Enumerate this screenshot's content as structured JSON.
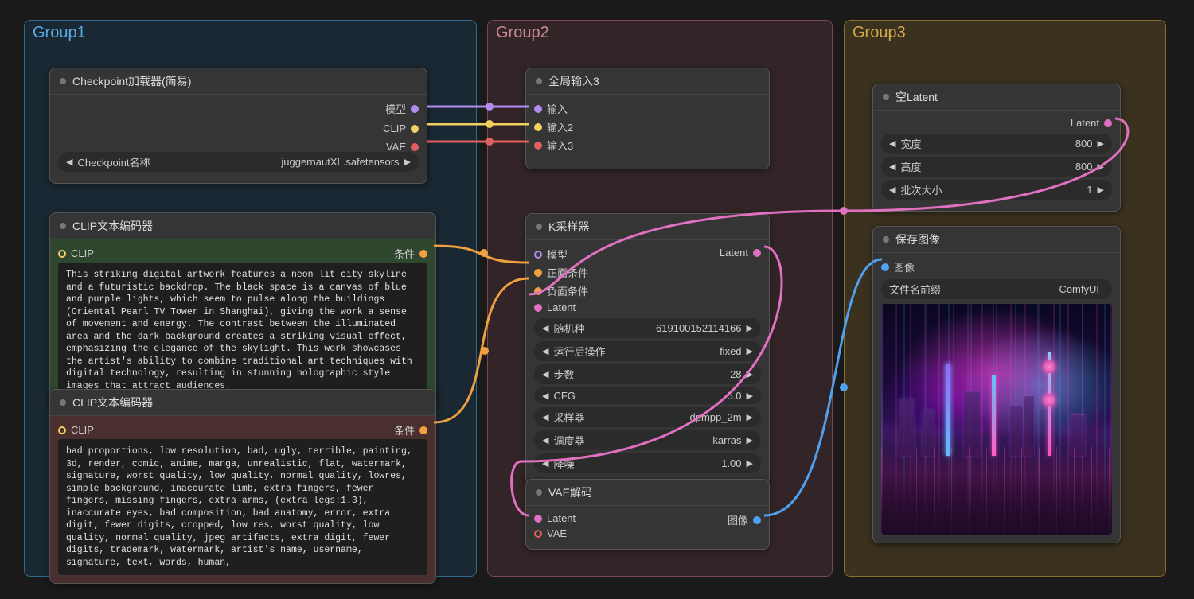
{
  "groups": {
    "g1": "Group1",
    "g2": "Group2",
    "g3": "Group3"
  },
  "nodes": {
    "checkpoint": {
      "title": "Checkpoint加载器(简易)",
      "outputs": {
        "model": "模型",
        "clip": "CLIP",
        "vae": "VAE"
      },
      "widget_label": "Checkpoint名称",
      "widget_value": "juggernautXL.safetensors"
    },
    "clip_pos": {
      "title": "CLIP文本编码器",
      "input": "CLIP",
      "output": "条件",
      "text": "This striking digital artwork features a neon lit city skyline and a futuristic backdrop. The black space is a canvas of blue and purple lights, which seem to pulse along the buildings (Oriental Pearl TV Tower in Shanghai), giving the work a sense of movement and energy. The contrast between the illuminated area and the dark background creates a striking visual effect, emphasizing the elegance of the skylight. This work showcases the artist's ability to combine traditional art techniques with digital technology, resulting in stunning holographic style images that attract audiences."
    },
    "clip_neg": {
      "title": "CLIP文本编码器",
      "input": "CLIP",
      "output": "条件",
      "text": "bad proportions, low resolution, bad, ugly, terrible, painting, 3d, render, comic, anime, manga, unrealistic, flat, watermark, signature, worst quality, low quality, normal quality, lowres, simple background, inaccurate limb, extra fingers, fewer fingers, missing fingers, extra arms, (extra legs:1.3), inaccurate eyes, bad composition, bad anatomy, error, extra digit, fewer digits, cropped, low res, worst quality, low quality, normal quality, jpeg artifacts, extra digit, fewer digits, trademark, watermark, artist's name, username, signature, text, words, human,"
    },
    "reroute": {
      "title": "全局输入3",
      "inputs": {
        "in1": "输入",
        "in2": "输入2",
        "in3": "输入3"
      }
    },
    "ksampler": {
      "title": "K采样器",
      "inputs": {
        "model": "模型",
        "pos": "正面条件",
        "neg": "负面条件",
        "latent": "Latent"
      },
      "output": "Latent",
      "widgets": {
        "seed": {
          "label": "随机种",
          "value": "619100152114166"
        },
        "after": {
          "label": "运行后操作",
          "value": "fixed"
        },
        "steps": {
          "label": "步数",
          "value": "28"
        },
        "cfg": {
          "label": "CFG",
          "value": "5.0"
        },
        "sampler": {
          "label": "采样器",
          "value": "dpmpp_2m"
        },
        "scheduler": {
          "label": "调度器",
          "value": "karras"
        },
        "denoise": {
          "label": "降噪",
          "value": "1.00"
        }
      }
    },
    "vae_decode": {
      "title": "VAE解码",
      "inputs": {
        "latent": "Latent",
        "vae": "VAE"
      },
      "output": "图像"
    },
    "empty_latent": {
      "title": "空Latent",
      "output": "Latent",
      "widgets": {
        "width": {
          "label": "宽度",
          "value": "800"
        },
        "height": {
          "label": "高度",
          "value": "800"
        },
        "batch": {
          "label": "批次大小",
          "value": "1"
        }
      }
    },
    "save_image": {
      "title": "保存图像",
      "input": "图像",
      "widget_label": "文件名前缀",
      "widget_value": "ComfyUI"
    }
  }
}
